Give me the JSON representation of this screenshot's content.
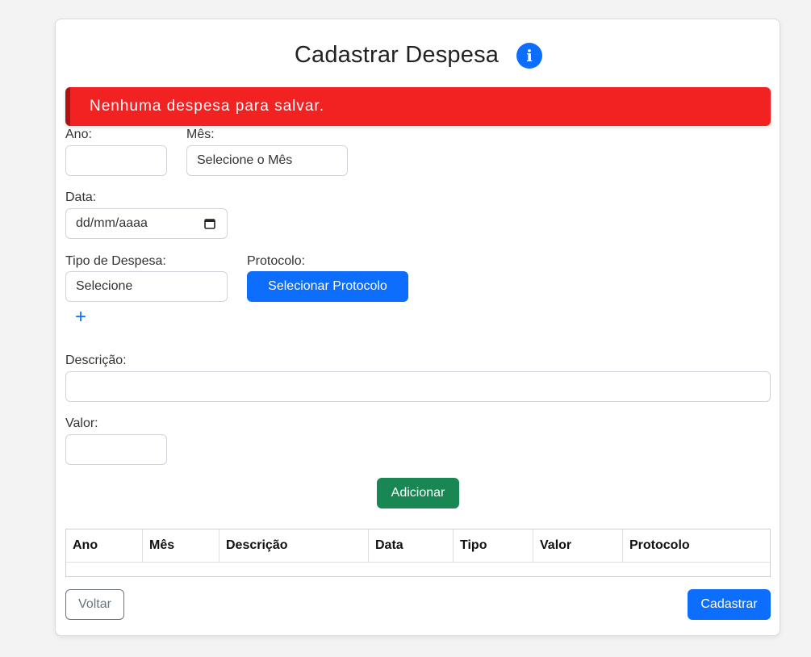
{
  "header": {
    "title": "Cadastrar Despesa",
    "info_icon": "info-circle-icon"
  },
  "alert": {
    "message": "Nenhuma despesa para salvar.",
    "color": "#f22222"
  },
  "form": {
    "ano_label": "Ano:",
    "ano_value": "",
    "mes_label": "Mês:",
    "mes_value": "Selecione o Mês",
    "data_label": "Data:",
    "data_placeholder": "dd/mm/aaaa",
    "tipo_label": "Tipo de Despesa:",
    "tipo_value": "Selecione",
    "add_tipo_icon": "plus-icon",
    "protocolo_label": "Protocolo:",
    "protocolo_button": "Selecionar Protocolo",
    "descricao_label": "Descrição:",
    "descricao_value": "",
    "valor_label": "Valor:",
    "valor_value": "",
    "adicionar_button": "Adicionar"
  },
  "table": {
    "columns": [
      "Ano",
      "Mês",
      "Descrição",
      "Data",
      "Tipo",
      "Valor",
      "Protocolo"
    ],
    "rows": []
  },
  "footer": {
    "voltar_button": "Voltar",
    "cadastrar_button": "Cadastrar"
  },
  "colors": {
    "primary": "#0d6efd",
    "success": "#198754",
    "danger": "#f22222",
    "secondary": "#6c757d"
  }
}
